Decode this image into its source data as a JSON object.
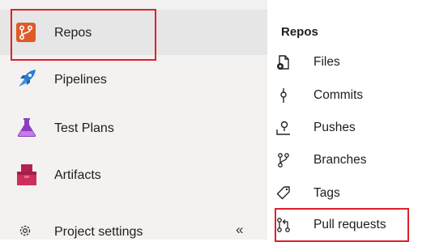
{
  "left_nav": {
    "items": [
      {
        "label": "Repos",
        "icon": "repos-icon"
      },
      {
        "label": "Pipelines",
        "icon": "pipelines-icon"
      },
      {
        "label": "Test Plans",
        "icon": "test-plans-icon"
      },
      {
        "label": "Artifacts",
        "icon": "artifacts-icon"
      }
    ],
    "settings_label": "Project settings",
    "collapse_glyph": "«"
  },
  "submenu": {
    "title": "Repos",
    "items": [
      {
        "label": "Files",
        "icon": "files-icon"
      },
      {
        "label": "Commits",
        "icon": "commits-icon"
      },
      {
        "label": "Pushes",
        "icon": "pushes-icon"
      },
      {
        "label": "Branches",
        "icon": "branches-icon"
      },
      {
        "label": "Tags",
        "icon": "tags-icon"
      },
      {
        "label": "Pull requests",
        "icon": "pull-requests-icon"
      }
    ]
  },
  "colors": {
    "highlight": "#e0202a",
    "repos_accent": "#e05a27",
    "pipelines_accent": "#2b7cd3",
    "test_plans_accent": "#8a3fbf",
    "artifacts_accent": "#cc2f5a"
  }
}
